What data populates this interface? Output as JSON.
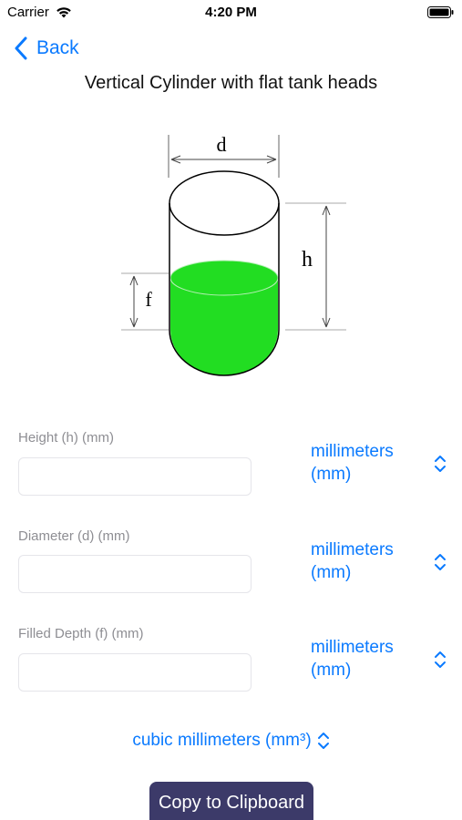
{
  "status": {
    "carrier": "Carrier",
    "time": "4:20 PM"
  },
  "nav": {
    "back_label": "Back"
  },
  "title": "Vertical Cylinder with flat tank heads",
  "diagram": {
    "label_d": "d",
    "label_h": "h",
    "label_f": "f",
    "fill_color": "#22dd22"
  },
  "fields": [
    {
      "label": "Height (h) (mm)",
      "value": "",
      "unit": "millimeters (mm)"
    },
    {
      "label": "Diameter (d) (mm)",
      "value": "",
      "unit": "millimeters (mm)"
    },
    {
      "label": "Filled Depth (f) (mm)",
      "value": "",
      "unit": "millimeters (mm)"
    }
  ],
  "result_unit": "cubic millimeters (mm³)",
  "copy_button": "Copy to Clipboard",
  "colors": {
    "accent": "#0a7aff",
    "button_bg": "#3c3a69"
  }
}
